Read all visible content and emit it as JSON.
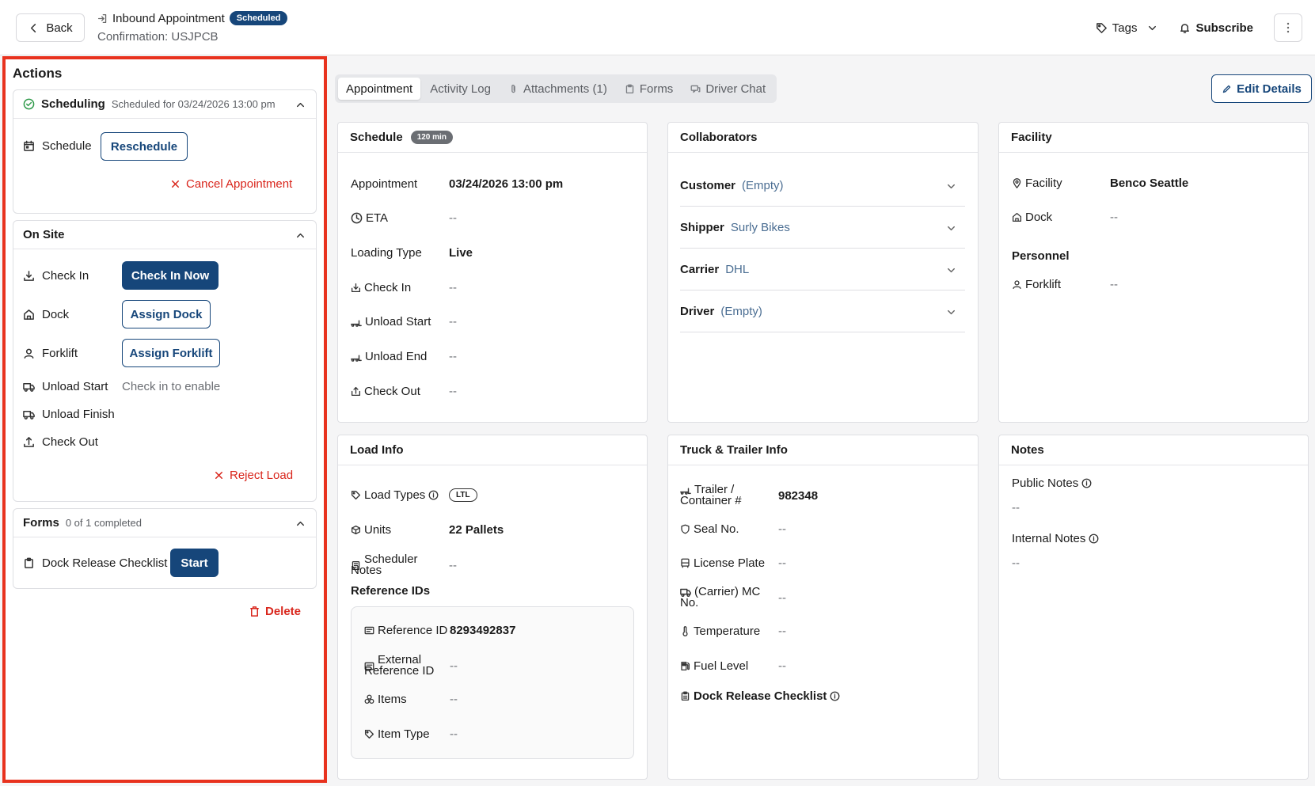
{
  "header": {
    "back_label": "Back",
    "title": "Inbound Appointment",
    "status_badge": "Scheduled",
    "confirmation": "Confirmation: USJPCB",
    "tags_label": "Tags",
    "subscribe_label": "Subscribe"
  },
  "actions": {
    "title": "Actions",
    "scheduling": {
      "title": "Scheduling",
      "subtitle": "Scheduled for 03/24/2026 13:00 pm",
      "schedule_label": "Schedule",
      "reschedule_button": "Reschedule",
      "cancel_link": "Cancel Appointment"
    },
    "on_site": {
      "title": "On Site",
      "check_in_label": "Check In",
      "check_in_button": "Check In Now",
      "dock_label": "Dock",
      "dock_button": "Assign Dock",
      "forklift_label": "Forklift",
      "forklift_button": "Assign Forklift",
      "unload_start_label": "Unload Start",
      "unload_start_hint": "Check in to enable",
      "unload_finish_label": "Unload Finish",
      "check_out_label": "Check Out",
      "reject_link": "Reject Load"
    },
    "forms": {
      "title": "Forms",
      "subtitle": "0 of 1 completed",
      "checklist_label": "Dock Release Checklist",
      "start_button": "Start"
    },
    "delete_label": "Delete"
  },
  "tabs": [
    "Appointment",
    "Activity Log",
    "Attachments (1)",
    "Forms",
    "Driver Chat"
  ],
  "edit_details_label": "Edit Details",
  "schedule": {
    "title": "Schedule",
    "duration_badge": "120 min",
    "appointment_label": "Appointment",
    "appointment_value": "03/24/2026 13:00 pm",
    "eta_label": "ETA",
    "eta_value": "--",
    "loading_type_label": "Loading Type",
    "loading_type_value": "Live",
    "check_in_label": "Check In",
    "check_in_value": "--",
    "unload_start_label": "Unload Start",
    "unload_start_value": "--",
    "unload_end_label": "Unload End",
    "unload_end_value": "--",
    "check_out_label": "Check Out",
    "check_out_value": "--"
  },
  "collaborators": {
    "title": "Collaborators",
    "customer_label": "Customer",
    "customer_value": "(Empty)",
    "shipper_label": "Shipper",
    "shipper_value": "Surly Bikes",
    "carrier_label": "Carrier",
    "carrier_value": "DHL",
    "driver_label": "Driver",
    "driver_value": "(Empty)"
  },
  "facility": {
    "title": "Facility",
    "facility_label": "Facility",
    "facility_value": "Benco Seattle",
    "dock_label": "Dock",
    "dock_value": "--",
    "personnel_heading": "Personnel",
    "forklift_label": "Forklift",
    "forklift_value": "--"
  },
  "load_info": {
    "title": "Load Info",
    "load_types_label": "Load Types",
    "load_types_value": "LTL",
    "units_label": "Units",
    "units_value": "22 Pallets",
    "scheduler_notes_label_1": "Scheduler",
    "scheduler_notes_label_2": "Notes",
    "scheduler_notes_value": "--",
    "reference_ids_heading": "Reference IDs",
    "reference_id_label": "Reference ID",
    "reference_id_value": "8293492837",
    "external_ref_label_1": "External",
    "external_ref_label_2": "Reference ID",
    "external_ref_value": "--",
    "items_label": "Items",
    "items_value": "--",
    "item_type_label": "Item Type",
    "item_type_value": "--"
  },
  "truck": {
    "title": "Truck & Trailer Info",
    "trailer_label_1": "Trailer /",
    "trailer_label_2": "Container #",
    "trailer_value": "982348",
    "seal_label": "Seal No.",
    "seal_value": "--",
    "license_label": "License Plate",
    "license_value": "--",
    "mc_label_1": "(Carrier) MC",
    "mc_label_2": "No.",
    "mc_value": "--",
    "temperature_label": "Temperature",
    "temperature_value": "--",
    "fuel_label": "Fuel Level",
    "fuel_value": "--",
    "checklist_label": "Dock Release Checklist"
  },
  "notes": {
    "title": "Notes",
    "public_label": "Public Notes",
    "public_value": "--",
    "internal_label": "Internal Notes",
    "internal_value": "--"
  },
  "colors": {
    "primary": "#16467a",
    "danger": "#d9261c",
    "highlight_border": "#e8321e"
  }
}
